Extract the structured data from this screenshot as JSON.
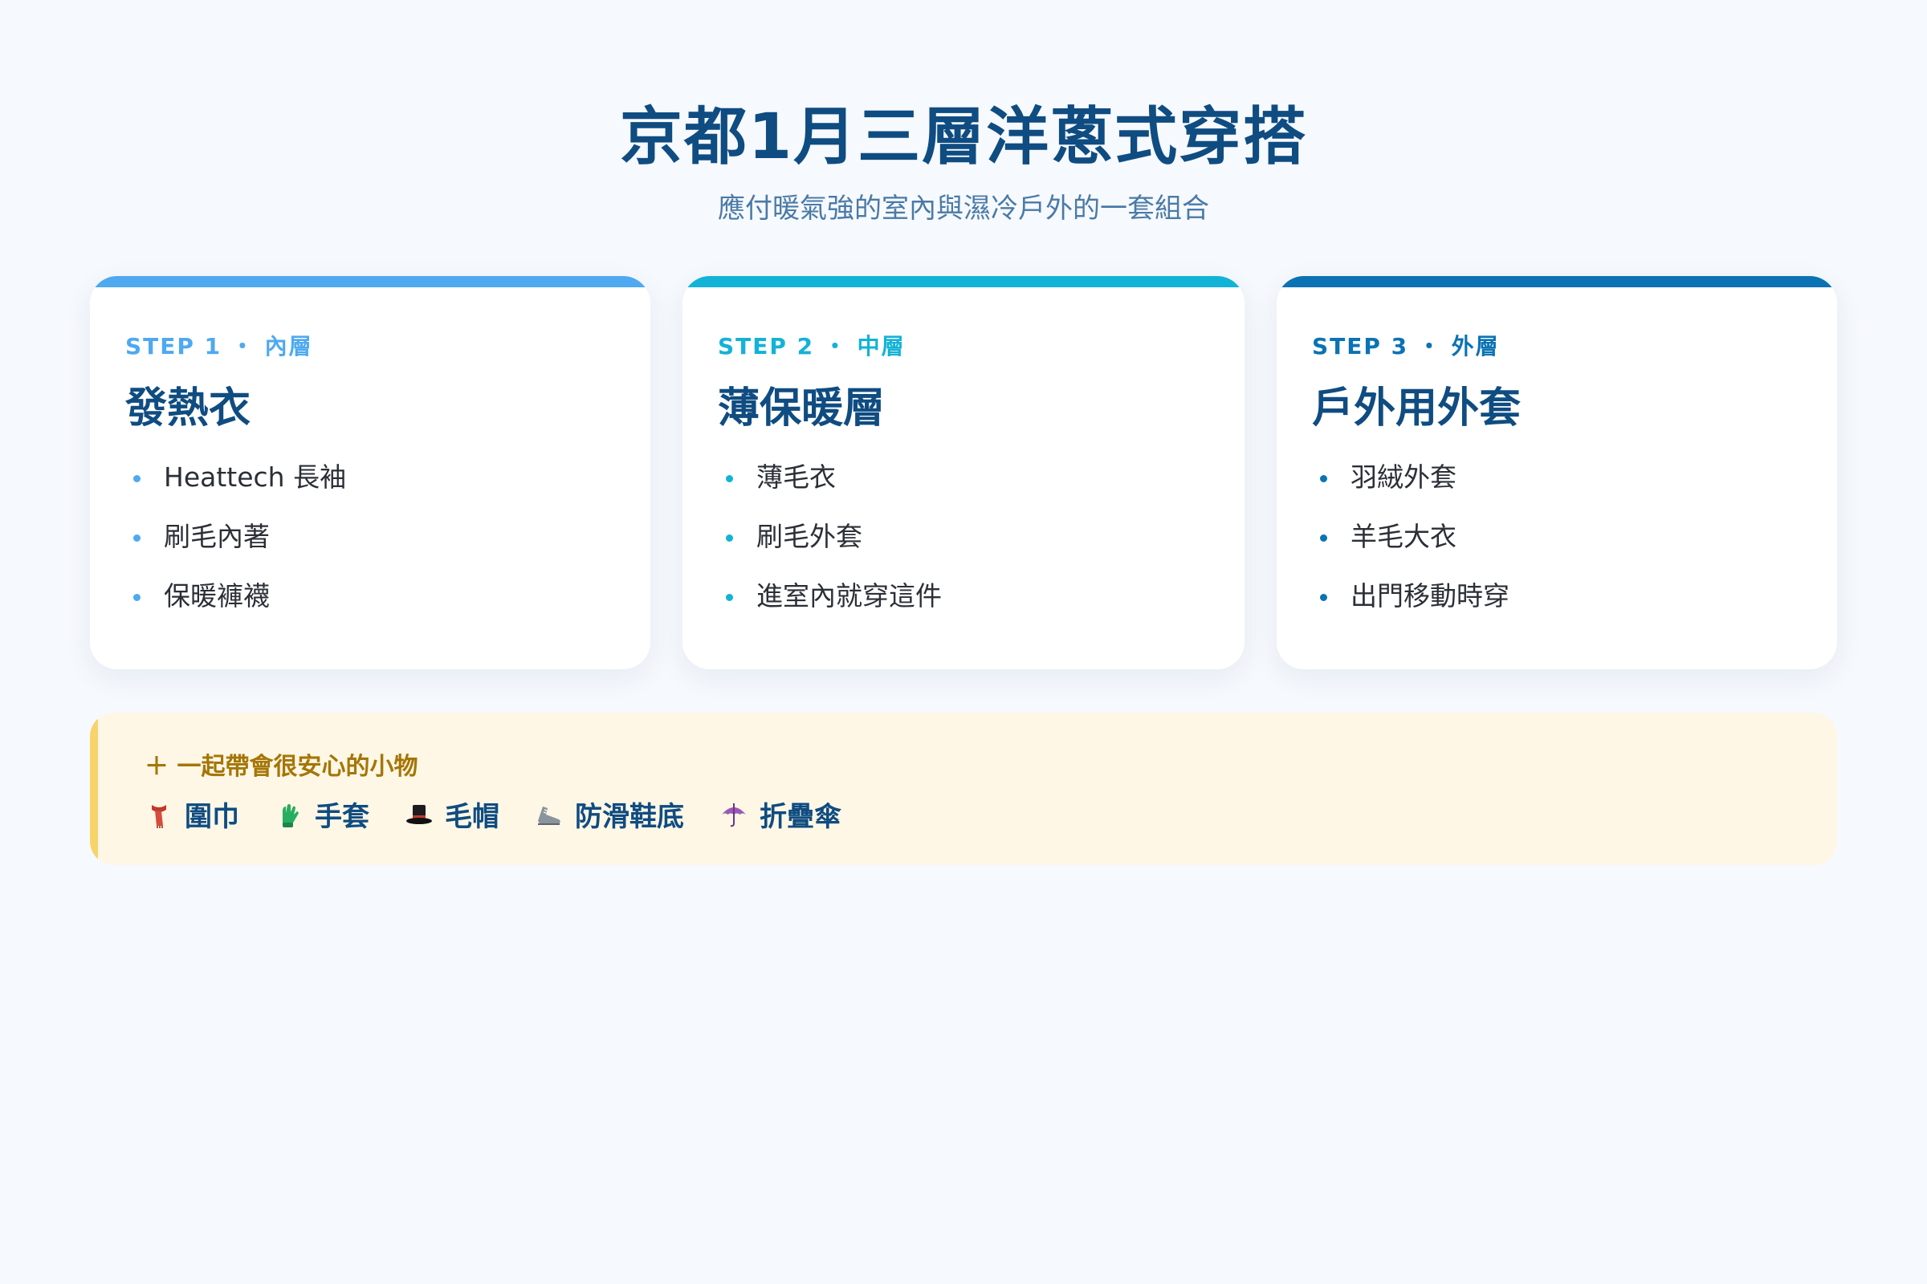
{
  "header": {
    "title": "京都1月三層洋蔥式穿搭",
    "subtitle": "應付暖氣強的室內與濕冷戶外的一套組合"
  },
  "cards": [
    {
      "step": "STEP 1 ・ 內層",
      "name": "發熱衣",
      "accent": "#4ea9f0",
      "items": [
        "Heattech 長袖",
        "刷毛內著",
        "保暖褲襪"
      ]
    },
    {
      "step": "STEP 2 ・ 中層",
      "name": "薄保暖層",
      "accent": "#12b3d6",
      "items": [
        "薄毛衣",
        "刷毛外套",
        "進室內就穿這件"
      ]
    },
    {
      "step": "STEP 3 ・ 外層",
      "name": "戶外用外套",
      "accent": "#0b73b3",
      "items": [
        "羽絨外套",
        "羊毛大衣",
        "出門移動時穿"
      ]
    }
  ],
  "extras": {
    "title": "＋ 一起帶會很安心的小物",
    "items": [
      {
        "label": "圍巾",
        "icon": "scarf-icon"
      },
      {
        "label": "手套",
        "icon": "gloves-icon"
      },
      {
        "label": "毛帽",
        "icon": "hat-icon"
      },
      {
        "label": "防滑鞋底",
        "icon": "shoe-icon"
      },
      {
        "label": "折疊傘",
        "icon": "umbrella-icon"
      }
    ]
  }
}
